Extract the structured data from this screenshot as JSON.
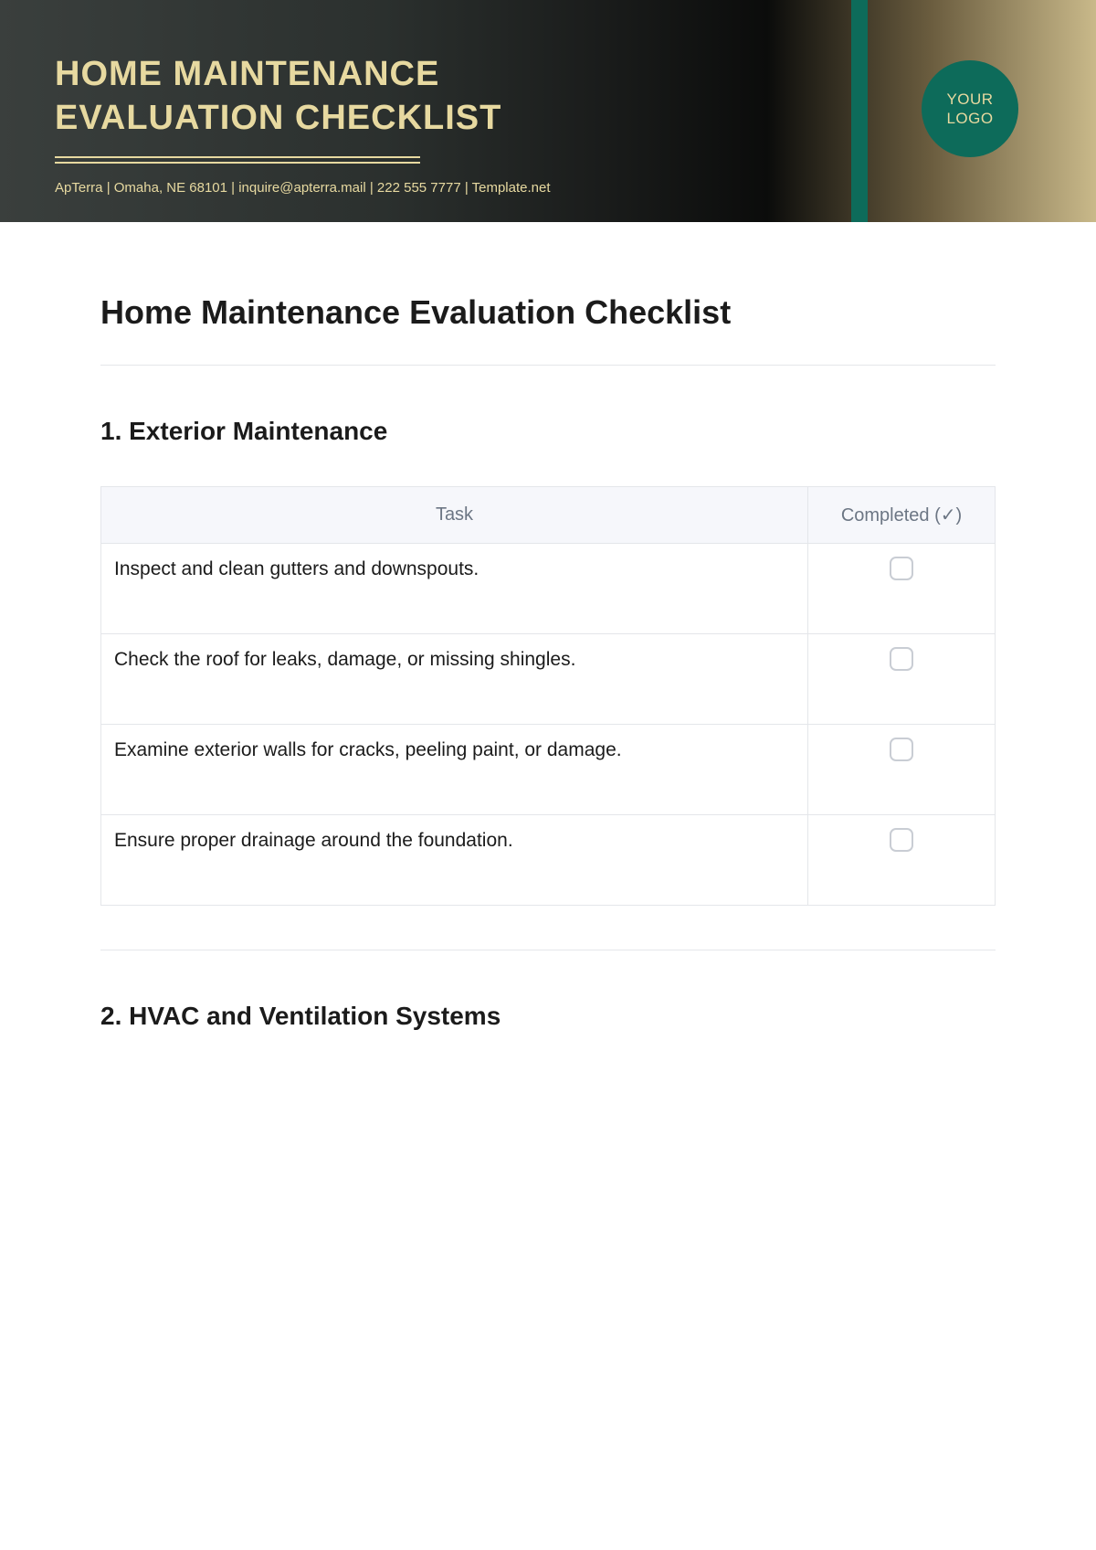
{
  "banner": {
    "title_line1": "HOME MAINTENANCE",
    "title_line2": "EVALUATION CHECKLIST",
    "meta": "ApTerra | Omaha, NE 68101 | inquire@apterra.mail | 222 555 7777 | Template.net",
    "logo_line1": "YOUR",
    "logo_line2": "LOGO"
  },
  "doc": {
    "title": "Home Maintenance Evaluation Checklist"
  },
  "sections": [
    {
      "title": "1. Exterior Maintenance",
      "columns": {
        "task": "Task",
        "completed": "Completed (✓)"
      },
      "tasks": [
        "Inspect and clean gutters and downspouts.",
        "Check the roof for leaks, damage, or missing shingles.",
        "Examine exterior walls for cracks, peeling paint, or damage.",
        "Ensure proper drainage around the foundation."
      ]
    },
    {
      "title": "2. HVAC and Ventilation Systems"
    }
  ]
}
